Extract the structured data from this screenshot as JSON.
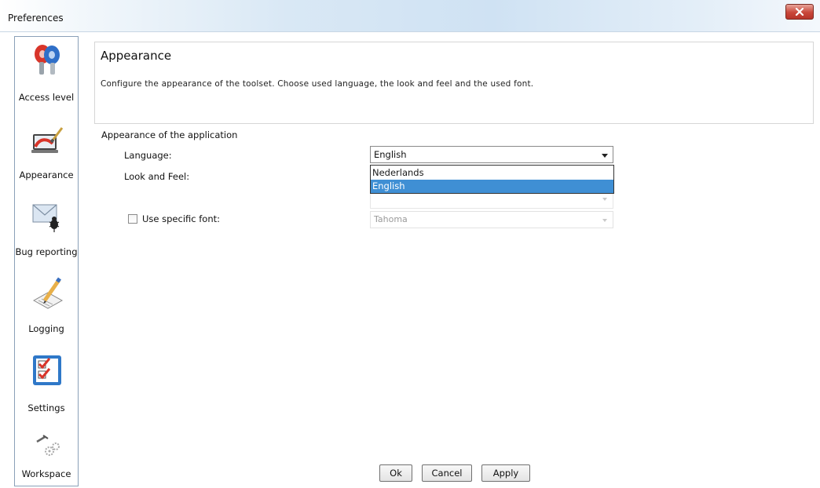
{
  "window": {
    "title": "Preferences",
    "close_label": "X"
  },
  "sidebar": {
    "items": [
      {
        "label": "Access level",
        "icon": "keys-icon"
      },
      {
        "label": "Appearance",
        "icon": "paint-laptop-icon"
      },
      {
        "label": "Bug reporting",
        "icon": "bug-envelope-icon"
      },
      {
        "label": "Logging",
        "icon": "pencil-paper-icon"
      },
      {
        "label": "Settings",
        "icon": "checklist-icon"
      },
      {
        "label": "Workspace",
        "icon": "tools-gears-icon"
      }
    ]
  },
  "header": {
    "title": "Appearance",
    "description": "Configure the appearance of the toolset. Choose used language, the look and feel and the used font."
  },
  "section": {
    "title": "Appearance of the application"
  },
  "fields": {
    "language_label": "Language:",
    "language_value": "English",
    "language_options": [
      "Nederlands",
      "English"
    ],
    "language_selected_index": 1,
    "look_and_feel_label": "Look and Feel:",
    "look_and_feel_value": "",
    "use_font_label": "Use specific font:",
    "use_font_checked": false,
    "font_value": "Tahoma"
  },
  "buttons": {
    "ok": "Ok",
    "cancel": "Cancel",
    "apply": "Apply"
  },
  "colors": {
    "selection": "#3f8fd4",
    "close_button": "#c9473a",
    "border": "#8aa0b8"
  }
}
